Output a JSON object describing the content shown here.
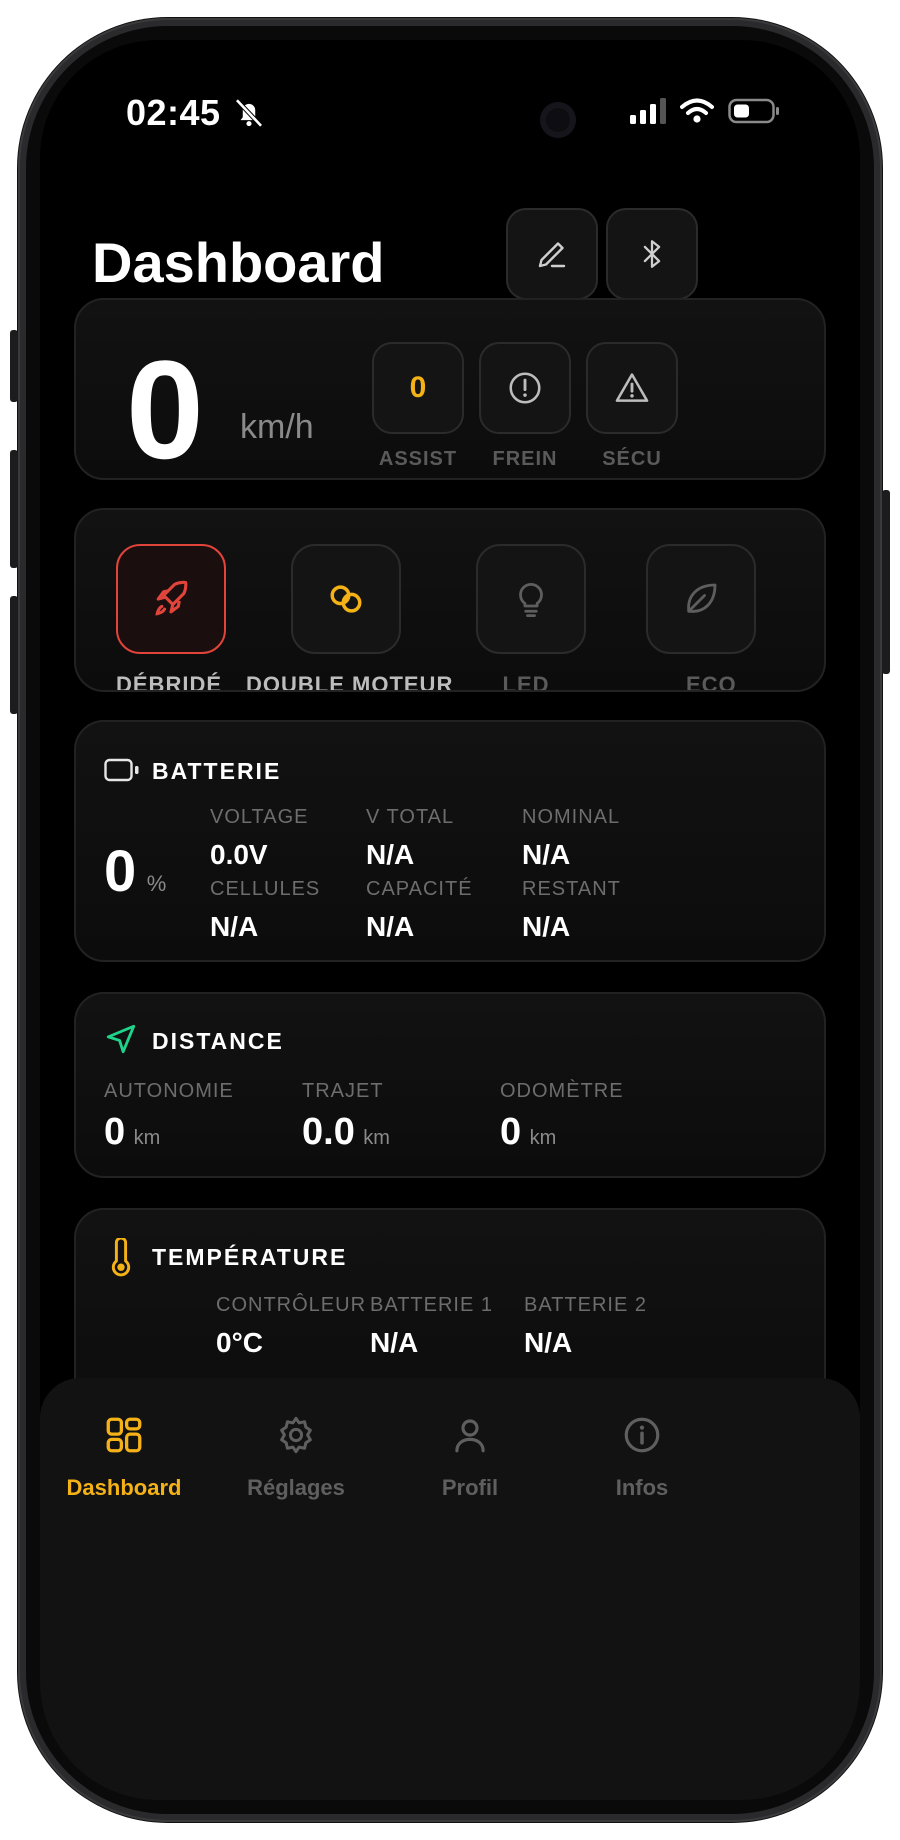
{
  "status_bar": {
    "time": "02:45"
  },
  "header": {
    "title": "Dashboard"
  },
  "speed_card": {
    "speed": "0",
    "unit": "km/h",
    "stats": [
      {
        "label": "ASSIST",
        "value": "0"
      },
      {
        "label": "FREIN"
      },
      {
        "label": "SÉCU"
      }
    ]
  },
  "modes": [
    {
      "label": "DÉBRIDÉ"
    },
    {
      "label": "DOUBLE MOTEUR"
    },
    {
      "label": "LED"
    },
    {
      "label": "ECO"
    }
  ],
  "battery": {
    "title": "BATTERIE",
    "percent": "0",
    "percent_unit": "%",
    "cells": [
      {
        "label": "VOLTAGE",
        "value": "0.0V"
      },
      {
        "label": "V TOTAL",
        "value": "N/A"
      },
      {
        "label": "NOMINAL",
        "value": "N/A"
      },
      {
        "label": "CELLULES",
        "value": "N/A"
      },
      {
        "label": "CAPACITÉ",
        "value": "N/A"
      },
      {
        "label": "RESTANT",
        "value": "N/A"
      }
    ]
  },
  "distance": {
    "title": "DISTANCE",
    "items": [
      {
        "label": "AUTONOMIE",
        "value": "0",
        "unit": "km"
      },
      {
        "label": "TRAJET",
        "value": "0.0",
        "unit": "km"
      },
      {
        "label": "ODOMÈTRE",
        "value": "0",
        "unit": "km"
      }
    ]
  },
  "temperature": {
    "title": "TEMPÉRATURE",
    "items": [
      {
        "label": "CONTRÔLEUR",
        "value": "0°C"
      },
      {
        "label": "BATTERIE 1",
        "value": "N/A"
      },
      {
        "label": "BATTERIE 2",
        "value": "N/A"
      }
    ]
  },
  "nav": [
    {
      "label": "Dashboard",
      "icon": "grid-icon",
      "active": true
    },
    {
      "label": "Réglages",
      "icon": "gear-icon"
    },
    {
      "label": "Profil",
      "icon": "user-icon"
    },
    {
      "label": "Infos",
      "icon": "info-icon"
    }
  ],
  "colors": {
    "accent": "#f5b217",
    "danger": "#e0443a",
    "success": "#1fd38a",
    "card_bg": "#111111",
    "background": "#000000"
  }
}
